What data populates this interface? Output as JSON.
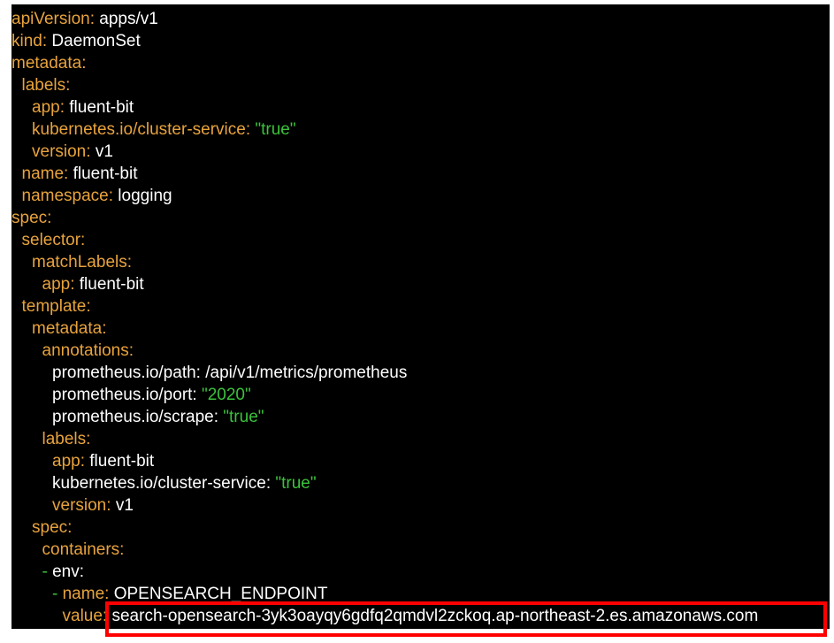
{
  "colors": {
    "background": "#000000",
    "key": "#e8a33d",
    "value": "#ffffff",
    "string": "#3cc23c",
    "highlight": "#ff0000"
  },
  "lines": [
    {
      "indent": 0,
      "key": "apiVersion",
      "value": "apps/v1",
      "type": "plain"
    },
    {
      "indent": 0,
      "key": "kind",
      "value": "DaemonSet",
      "type": "plain"
    },
    {
      "indent": 0,
      "key": "metadata",
      "value": "",
      "type": "plain"
    },
    {
      "indent": 1,
      "key": "labels",
      "value": "",
      "type": "plain"
    },
    {
      "indent": 2,
      "key": "app",
      "value": "fluent-bit",
      "type": "plain"
    },
    {
      "indent": 2,
      "key": "kubernetes.io/cluster-service",
      "value": "\"true\"",
      "type": "string"
    },
    {
      "indent": 2,
      "key": "version",
      "value": "v1",
      "type": "plain"
    },
    {
      "indent": 1,
      "key": "name",
      "value": "fluent-bit",
      "type": "plain"
    },
    {
      "indent": 1,
      "key": "namespace",
      "value": "logging",
      "type": "plain"
    },
    {
      "indent": 0,
      "key": "spec",
      "value": "",
      "type": "plain"
    },
    {
      "indent": 1,
      "key": "selector",
      "value": "",
      "type": "plain"
    },
    {
      "indent": 2,
      "key": "matchLabels",
      "value": "",
      "type": "plain"
    },
    {
      "indent": 3,
      "key": "app",
      "value": "fluent-bit",
      "type": "plain"
    },
    {
      "indent": 1,
      "key": "template",
      "value": "",
      "type": "plain"
    },
    {
      "indent": 2,
      "key": "metadata",
      "value": "",
      "type": "plain"
    },
    {
      "indent": 3,
      "key": "annotations",
      "value": "",
      "type": "plain"
    },
    {
      "indent": 4,
      "key": "prometheus.io/path",
      "value": "/api/v1/metrics/prometheus",
      "type": "plainkeywhite"
    },
    {
      "indent": 4,
      "key": "prometheus.io/port",
      "value": "\"2020\"",
      "type": "stringkeywhite"
    },
    {
      "indent": 4,
      "key": "prometheus.io/scrape",
      "value": "\"true\"",
      "type": "stringkeywhite"
    },
    {
      "indent": 3,
      "key": "labels",
      "value": "",
      "type": "plain"
    },
    {
      "indent": 4,
      "key": "app",
      "value": "fluent-bit",
      "type": "plain"
    },
    {
      "indent": 4,
      "key": "kubernetes.io/cluster-service",
      "value": "\"true\"",
      "type": "stringkeywhite"
    },
    {
      "indent": 4,
      "key": "version",
      "value": "v1",
      "type": "plain"
    },
    {
      "indent": 2,
      "key": "spec",
      "value": "",
      "type": "plain"
    },
    {
      "indent": 3,
      "key": "containers",
      "value": "",
      "type": "plain"
    },
    {
      "indent": 3,
      "dash": "-",
      "key": "env",
      "value": "",
      "type": "dashwhite"
    },
    {
      "indent": 4,
      "dash": "-",
      "key": "name",
      "value": "OPENSEARCH_ENDPOINT",
      "type": "dash"
    },
    {
      "indent": 5,
      "key": "value",
      "value": "search-opensearch-3yk3oayqy6gdfq2qmdvl2zckoq.ap-northeast-2.es.amazonaws.com",
      "type": "plain"
    }
  ]
}
